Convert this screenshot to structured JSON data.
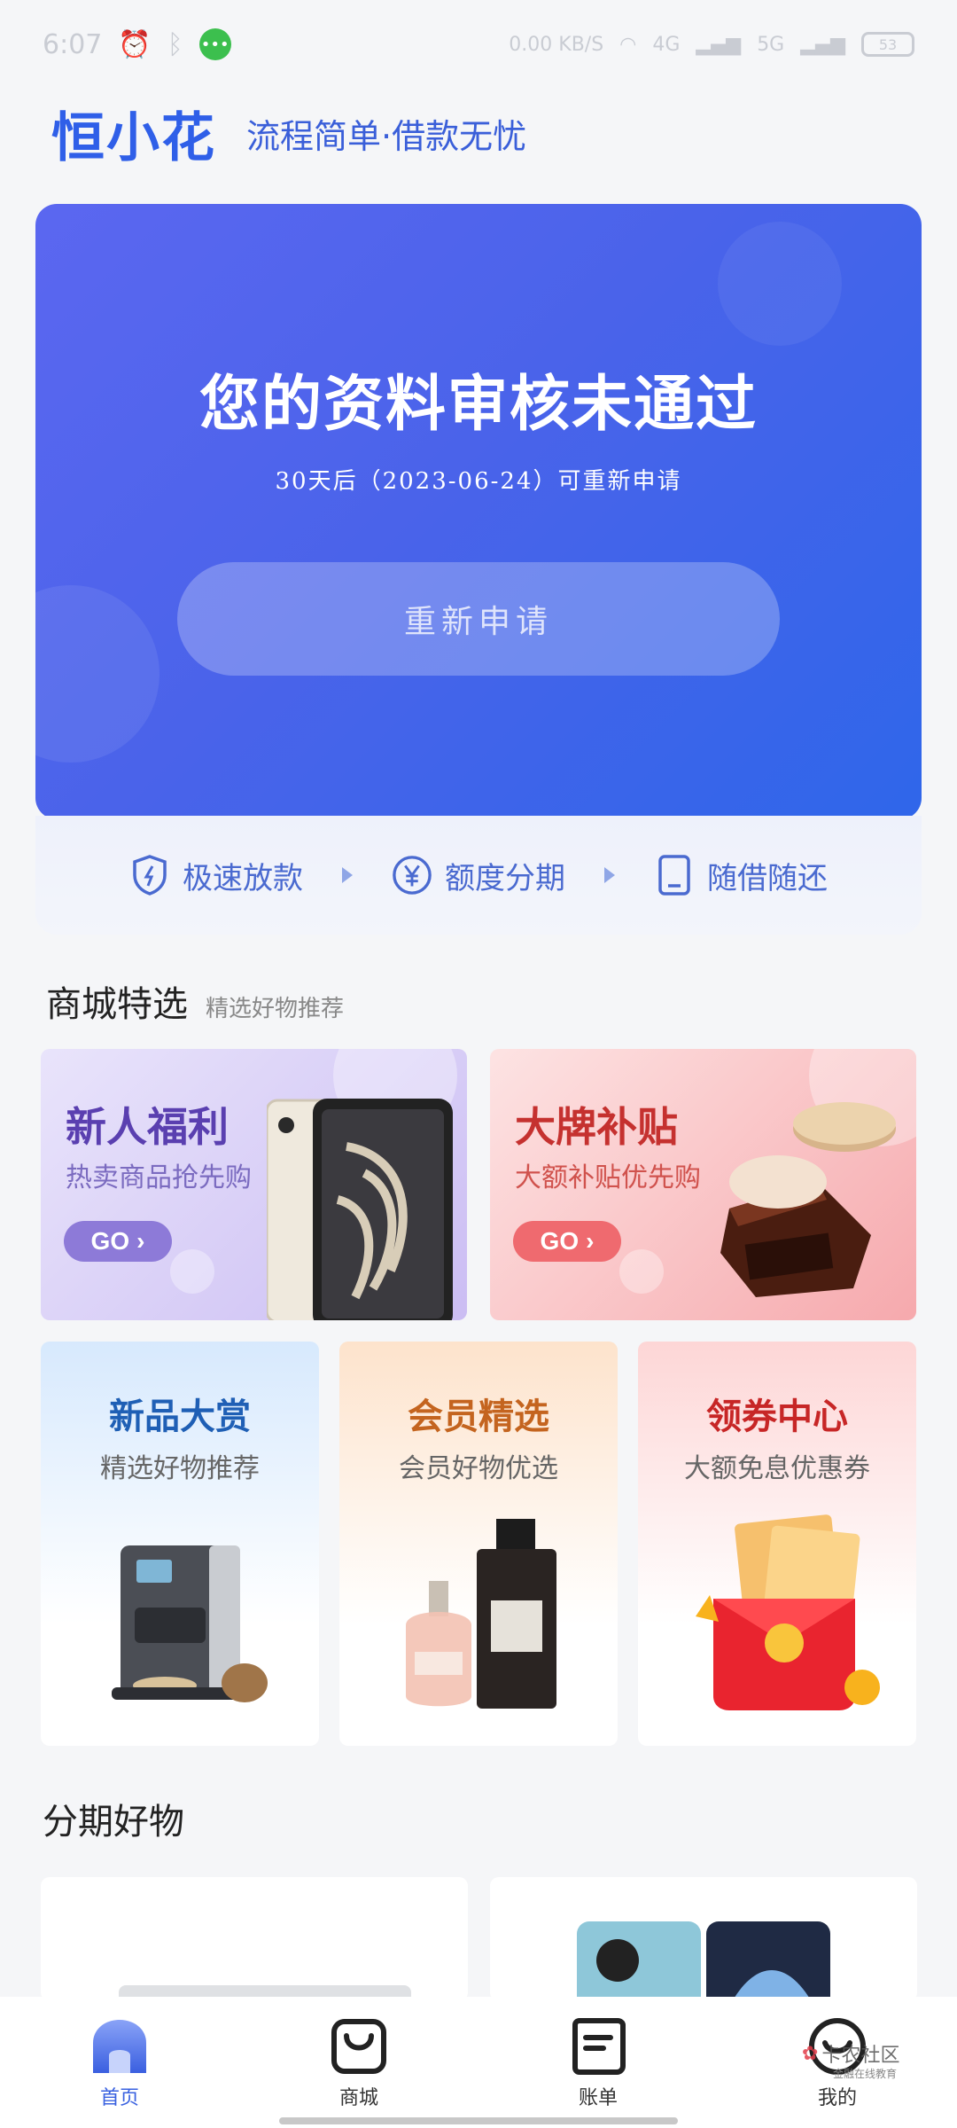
{
  "status_bar": {
    "time": "6:07",
    "network_speed": "0.00 KB/S",
    "signal_1": "4G",
    "signal_2": "5G",
    "battery": "53"
  },
  "header": {
    "logo": "恒小花",
    "slogan": "流程简单·借款无忧"
  },
  "hero": {
    "title": "您的资料审核未通过",
    "subtitle": "30天后（2023-06-24）可重新申请",
    "button_label": "重新申请"
  },
  "features": [
    {
      "label": "极速放款",
      "icon": "shield-icon"
    },
    {
      "label": "额度分期",
      "icon": "yen-icon"
    },
    {
      "label": "随借随还",
      "icon": "phone-icon"
    }
  ],
  "mall_section": {
    "title": "商城特选",
    "subtitle": "精选好物推荐"
  },
  "promos_big": [
    {
      "title": "新人福利",
      "subtitle": "热卖商品抢先购",
      "button": "GO"
    },
    {
      "title": "大牌补贴",
      "subtitle": "大额补贴优先购",
      "button": "GO"
    }
  ],
  "promos_small": [
    {
      "title": "新品大赏",
      "subtitle": "精选好物推荐"
    },
    {
      "title": "会员精选",
      "subtitle": "会员好物优选"
    },
    {
      "title": "领券中心",
      "subtitle": "大额免息优惠券"
    }
  ],
  "installment_section": {
    "title": "分期好物"
  },
  "tab_bar": [
    {
      "label": "首页",
      "icon": "home-icon",
      "active": true
    },
    {
      "label": "商城",
      "icon": "bag-icon",
      "active": false
    },
    {
      "label": "账单",
      "icon": "bill-icon",
      "active": false
    },
    {
      "label": "我的",
      "icon": "profile-icon",
      "active": false
    }
  ],
  "watermark": {
    "text": "卡农社区",
    "sub": "金融在线教育"
  },
  "colors": {
    "accent": "#3a62e0",
    "hero_start": "#5b67f0",
    "hero_end": "#2f66ea"
  }
}
